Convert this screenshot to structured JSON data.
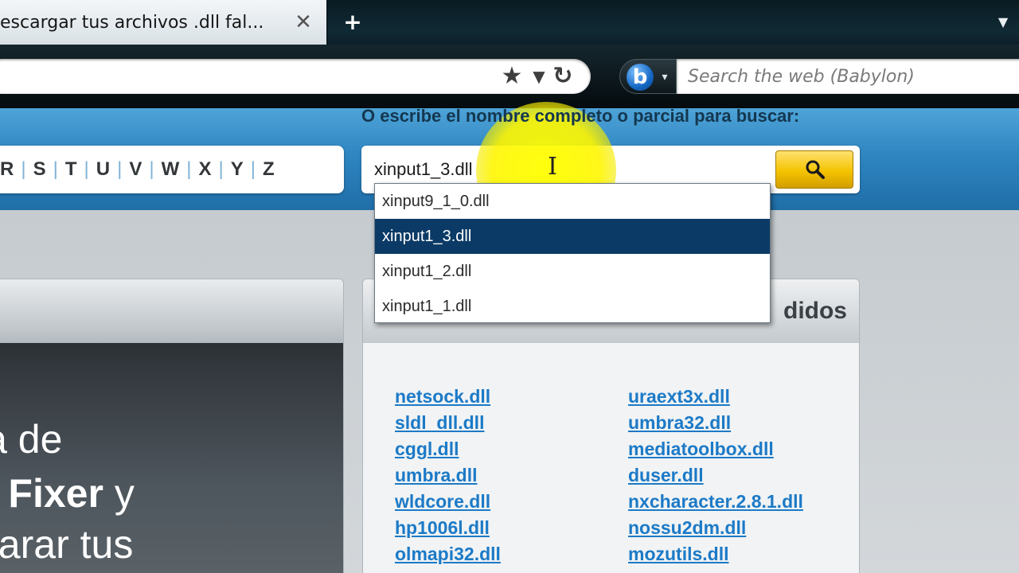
{
  "browser": {
    "tab_title": "escargar tus archivos .dll fal...",
    "tab_close": "✕",
    "new_tab": "+",
    "tab_list": "▼",
    "address_icons": {
      "bookmark": "★",
      "dropdown": "▼",
      "reload": "↻"
    },
    "search_engine": {
      "logo": "b",
      "caret": "▾"
    },
    "search_placeholder": "Search the web (Babylon)"
  },
  "page": {
    "instruction": "O escribe el nombre completo o parcial para buscar:",
    "alphabet": [
      "R",
      "S",
      "T",
      "U",
      "V",
      "W",
      "X",
      "Y",
      "Z"
    ],
    "alphabet_separator": "|",
    "search": {
      "value": "xinput1_3.dll",
      "suggestions": [
        "xinput9_1_0.dll",
        "xinput1_3.dll",
        "xinput1_2.dll",
        "xinput1_1.dll"
      ],
      "selected_suggestion": "xinput1_3.dll"
    },
    "cursor": "I",
    "panels": {
      "right_title": "didos",
      "promo_lines": [
        {
          "text": "ia de"
        },
        {
          "bold": "n Fixer",
          "text": " y"
        },
        {
          "text": "parar tus"
        }
      ]
    },
    "dll_links": {
      "column1": [
        "netsock.dll",
        "sldl_dll.dll",
        "cggl.dll",
        "umbra.dll",
        "wldcore.dll",
        "hp1006l.dll",
        "olmapi32.dll"
      ],
      "column2": [
        "uraext3x.dll",
        "umbra32.dll",
        "mediatoolbox.dll",
        "duser.dll",
        "nxcharacter.2.8.1.dll",
        "nossu2dm.dll",
        "mozutils.dll"
      ]
    }
  },
  "colors": {
    "banner_blue": "#2f86c1",
    "link_blue": "#1c7ac7",
    "selected_row": "#0b3a66",
    "search_button": "#f4c300",
    "highlight": "#fff600"
  }
}
